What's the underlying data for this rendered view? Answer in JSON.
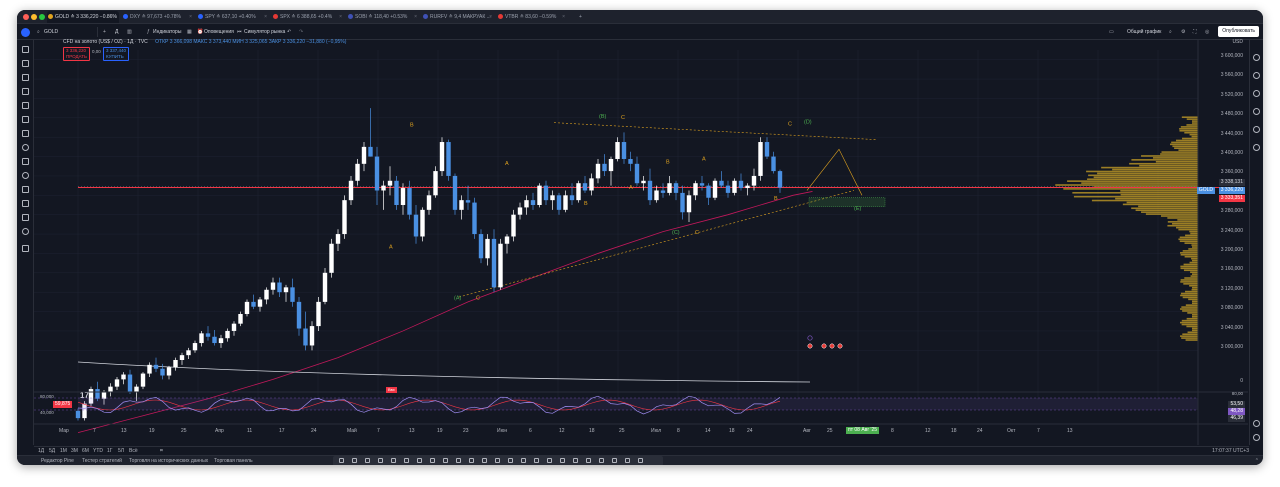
{
  "tabs": [
    {
      "label": "GOLD ≙ 3 336,220 −0.86%",
      "dot": "#e0a31f",
      "active": true
    },
    {
      "label": "DXY ≙ 97,673 +0.78%",
      "dot": "#2962ff",
      "active": false
    },
    {
      "label": "SPY ≙ 637,10 +0.40%",
      "dot": "#2962ff",
      "active": false
    },
    {
      "label": "SPX ≙ 6 388,65 +0.4%",
      "dot": "#e53935",
      "active": false
    },
    {
      "label": "SOBI ≙ 118,40 +0.53%",
      "dot": "#3f51b5",
      "active": false
    },
    {
      "label": "RURFV ≙ 9,4 МАКРУАК ...",
      "dot": "#3f51b5",
      "active": false
    },
    {
      "label": "VTBR ≙ 83,60 −0.59%",
      "dot": "#e53935",
      "active": false
    }
  ],
  "toolbar": {
    "symbol": "GOLD",
    "timeframe": "Д",
    "indicators": "Индикаторы",
    "alerts": "Оповещения",
    "replay": "Симулятор рынка",
    "layout_label": "Общий график",
    "publish": "Опубликовать"
  },
  "legend": {
    "title": "CFD на золото (US$ / OZ) · 1Д · TVC",
    "ohlc": "ОТКР 3 366,098 МАКС 3 373,440 МИН 3 325,065 ЗАКР 3 336,220 −31,880 (−0,95%)",
    "sell_price": "3 336,220",
    "sell_label": "ПРОДАТЬ",
    "spread": "0,00",
    "buy_price": "3 337,440",
    "buy_label": "КУПИТЬ",
    "currency": "USD",
    "rsi_level_left": "59,875",
    "rsi_80": "80,000",
    "rsi_40": "40,000",
    "rsi_label_1": "53,50",
    "rsi_label_2": "48,28",
    "rsi_label_3": "46,39",
    "rsi_80_right": "80,00",
    "rsi_marker": "Ввх"
  },
  "price_axis": [
    "3 600,000",
    "3 560,000",
    "3 520,000",
    "3 480,000",
    "3 440,000",
    "3 400,000",
    "3 360,000",
    "3 320,000",
    "3 280,000",
    "3 240,000",
    "3 200,000",
    "3 160,000",
    "3 120,000",
    "3 080,000",
    "3 040,000",
    "3 000,000",
    "0"
  ],
  "price_tags": {
    "upper": "3 338,131",
    "current": "3 336,220",
    "current_name": "GOLD",
    "lower": "3 333,351"
  },
  "time_axis": [
    "Мар",
    "7",
    "13",
    "19",
    "25",
    "Апр",
    "11",
    "17",
    "24",
    "Май",
    "7",
    "13",
    "19",
    "23",
    "Июн",
    "6",
    "12",
    "18",
    "25",
    "Июл",
    "8",
    "14",
    "18",
    "24",
    "Авг",
    "25",
    "Сен",
    "8",
    "12",
    "18",
    "24",
    "Окт",
    "7",
    "13"
  ],
  "time_cursor": "пт 08 Авг '25",
  "range_buttons": [
    "1Д",
    "5Д",
    "1М",
    "3М",
    "6М",
    "YTD",
    "1Г",
    "5Л",
    "Всё"
  ],
  "clock": "17:07:37 UTC+3",
  "footer": [
    "Редактор Pine",
    "Тестер стратегий",
    "Торговля на исторических данных",
    "Торговая панель"
  ],
  "wave_labels": [
    "(A)",
    "(B)",
    "(C)",
    "(D)",
    "(E)",
    "A",
    "B",
    "C"
  ],
  "colors": {
    "bg": "#131722",
    "up": "#ffffff",
    "down": "#4a90e2",
    "ma": "#c2185b",
    "price_line": "#f23645",
    "volume_profile": "#c9a227",
    "rsi": "#7e57c2",
    "wave_green": "#4caf50",
    "wave_orange": "#e0a31f"
  },
  "chart_data": {
    "type": "candlestick",
    "symbol": "GOLD",
    "ylim": [
      2980,
      3620
    ],
    "candles": [
      [
        2875,
        2880,
        2855,
        2860
      ],
      [
        2860,
        2895,
        2855,
        2890
      ],
      [
        2890,
        2925,
        2885,
        2920
      ],
      [
        2920,
        2935,
        2895,
        2900
      ],
      [
        2900,
        2918,
        2888,
        2915
      ],
      [
        2915,
        2932,
        2905,
        2925
      ],
      [
        2925,
        2945,
        2918,
        2940
      ],
      [
        2940,
        2955,
        2930,
        2950
      ],
      [
        2950,
        2960,
        2910,
        2915
      ],
      [
        2915,
        2930,
        2895,
        2925
      ],
      [
        2925,
        2955,
        2920,
        2952
      ],
      [
        2952,
        2975,
        2945,
        2970
      ],
      [
        2970,
        2985,
        2955,
        2962
      ],
      [
        2962,
        2972,
        2940,
        2948
      ],
      [
        2948,
        2968,
        2940,
        2965
      ],
      [
        2965,
        2985,
        2958,
        2980
      ],
      [
        2980,
        2995,
        2970,
        2990
      ],
      [
        2990,
        3005,
        2982,
        3000
      ],
      [
        3000,
        3020,
        2995,
        3015
      ],
      [
        3015,
        3040,
        3008,
        3035
      ],
      [
        3035,
        3050,
        3020,
        3028
      ],
      [
        3028,
        3042,
        3010,
        3015
      ],
      [
        3015,
        3032,
        3005,
        3025
      ],
      [
        3025,
        3045,
        3018,
        3040
      ],
      [
        3040,
        3060,
        3030,
        3055
      ],
      [
        3055,
        3080,
        3050,
        3075
      ],
      [
        3075,
        3105,
        3070,
        3100
      ],
      [
        3100,
        3115,
        3085,
        3090
      ],
      [
        3090,
        3110,
        3080,
        3105
      ],
      [
        3105,
        3130,
        3095,
        3125
      ],
      [
        3125,
        3150,
        3115,
        3140
      ],
      [
        3140,
        3150,
        3110,
        3120
      ],
      [
        3120,
        3135,
        3100,
        3130
      ],
      [
        3130,
        3148,
        3090,
        3100
      ],
      [
        3100,
        3110,
        3030,
        3045
      ],
      [
        3045,
        3080,
        3000,
        3010
      ],
      [
        3010,
        3060,
        3000,
        3050
      ],
      [
        3050,
        3110,
        3040,
        3100
      ],
      [
        3100,
        3170,
        3095,
        3160
      ],
      [
        3160,
        3230,
        3150,
        3220
      ],
      [
        3220,
        3250,
        3205,
        3240
      ],
      [
        3240,
        3320,
        3230,
        3310
      ],
      [
        3310,
        3360,
        3300,
        3350
      ],
      [
        3350,
        3395,
        3340,
        3385
      ],
      [
        3385,
        3430,
        3370,
        3420
      ],
      [
        3420,
        3500,
        3400,
        3400
      ],
      [
        3400,
        3420,
        3300,
        3330
      ],
      [
        3330,
        3350,
        3290,
        3340
      ],
      [
        3340,
        3380,
        3320,
        3350
      ],
      [
        3350,
        3360,
        3290,
        3300
      ],
      [
        3300,
        3345,
        3280,
        3335
      ],
      [
        3335,
        3350,
        3270,
        3280
      ],
      [
        3280,
        3300,
        3220,
        3235
      ],
      [
        3235,
        3295,
        3225,
        3290
      ],
      [
        3290,
        3330,
        3280,
        3320
      ],
      [
        3320,
        3380,
        3315,
        3370
      ],
      [
        3370,
        3440,
        3360,
        3430
      ],
      [
        3430,
        3435,
        3350,
        3360
      ],
      [
        3360,
        3365,
        3280,
        3290
      ],
      [
        3290,
        3320,
        3270,
        3310
      ],
      [
        3310,
        3340,
        3290,
        3305
      ],
      [
        3305,
        3315,
        3230,
        3240
      ],
      [
        3240,
        3250,
        3180,
        3190
      ],
      [
        3190,
        3240,
        3175,
        3230
      ],
      [
        3230,
        3250,
        3120,
        3130
      ],
      [
        3130,
        3230,
        3125,
        3220
      ],
      [
        3220,
        3240,
        3200,
        3235
      ],
      [
        3235,
        3290,
        3225,
        3280
      ],
      [
        3280,
        3305,
        3270,
        3295
      ],
      [
        3295,
        3320,
        3280,
        3310
      ],
      [
        3310,
        3325,
        3290,
        3300
      ],
      [
        3300,
        3345,
        3295,
        3340
      ],
      [
        3340,
        3350,
        3300,
        3310
      ],
      [
        3310,
        3330,
        3290,
        3320
      ],
      [
        3320,
        3325,
        3280,
        3290
      ],
      [
        3290,
        3330,
        3285,
        3320
      ],
      [
        3320,
        3345,
        3300,
        3310
      ],
      [
        3310,
        3350,
        3305,
        3345
      ],
      [
        3345,
        3360,
        3325,
        3330
      ],
      [
        3330,
        3365,
        3320,
        3355
      ],
      [
        3355,
        3395,
        3345,
        3385
      ],
      [
        3385,
        3405,
        3360,
        3370
      ],
      [
        3370,
        3400,
        3340,
        3395
      ],
      [
        3395,
        3440,
        3390,
        3430
      ],
      [
        3430,
        3450,
        3385,
        3395
      ],
      [
        3395,
        3410,
        3370,
        3385
      ],
      [
        3385,
        3400,
        3340,
        3345
      ],
      [
        3345,
        3360,
        3330,
        3350
      ],
      [
        3350,
        3375,
        3300,
        3310
      ],
      [
        3310,
        3340,
        3305,
        3330
      ],
      [
        3330,
        3345,
        3315,
        3325
      ],
      [
        3325,
        3360,
        3320,
        3345
      ],
      [
        3345,
        3350,
        3310,
        3325
      ],
      [
        3325,
        3340,
        3270,
        3285
      ],
      [
        3285,
        3330,
        3265,
        3320
      ],
      [
        3320,
        3350,
        3310,
        3345
      ],
      [
        3345,
        3360,
        3330,
        3340
      ],
      [
        3340,
        3345,
        3300,
        3315
      ],
      [
        3315,
        3355,
        3310,
        3350
      ],
      [
        3350,
        3370,
        3335,
        3340
      ],
      [
        3340,
        3350,
        3315,
        3325
      ],
      [
        3325,
        3355,
        3320,
        3350
      ],
      [
        3350,
        3365,
        3330,
        3335
      ],
      [
        3335,
        3345,
        3320,
        3340
      ],
      [
        3340,
        3375,
        3330,
        3360
      ],
      [
        3360,
        3440,
        3350,
        3430
      ],
      [
        3430,
        3440,
        3395,
        3400
      ],
      [
        3400,
        3410,
        3365,
        3370
      ],
      [
        3370,
        3373,
        3325,
        3336
      ]
    ],
    "ma": [
      [
        0,
        2830
      ],
      [
        10,
        2865
      ],
      [
        20,
        2900
      ],
      [
        30,
        2940
      ],
      [
        40,
        2985
      ],
      [
        50,
        3040
      ],
      [
        60,
        3100
      ],
      [
        70,
        3150
      ],
      [
        80,
        3200
      ],
      [
        90,
        3245
      ],
      [
        100,
        3280
      ],
      [
        110,
        3320
      ],
      [
        113,
        3328
      ]
    ],
    "price_line": 3336.22
  }
}
